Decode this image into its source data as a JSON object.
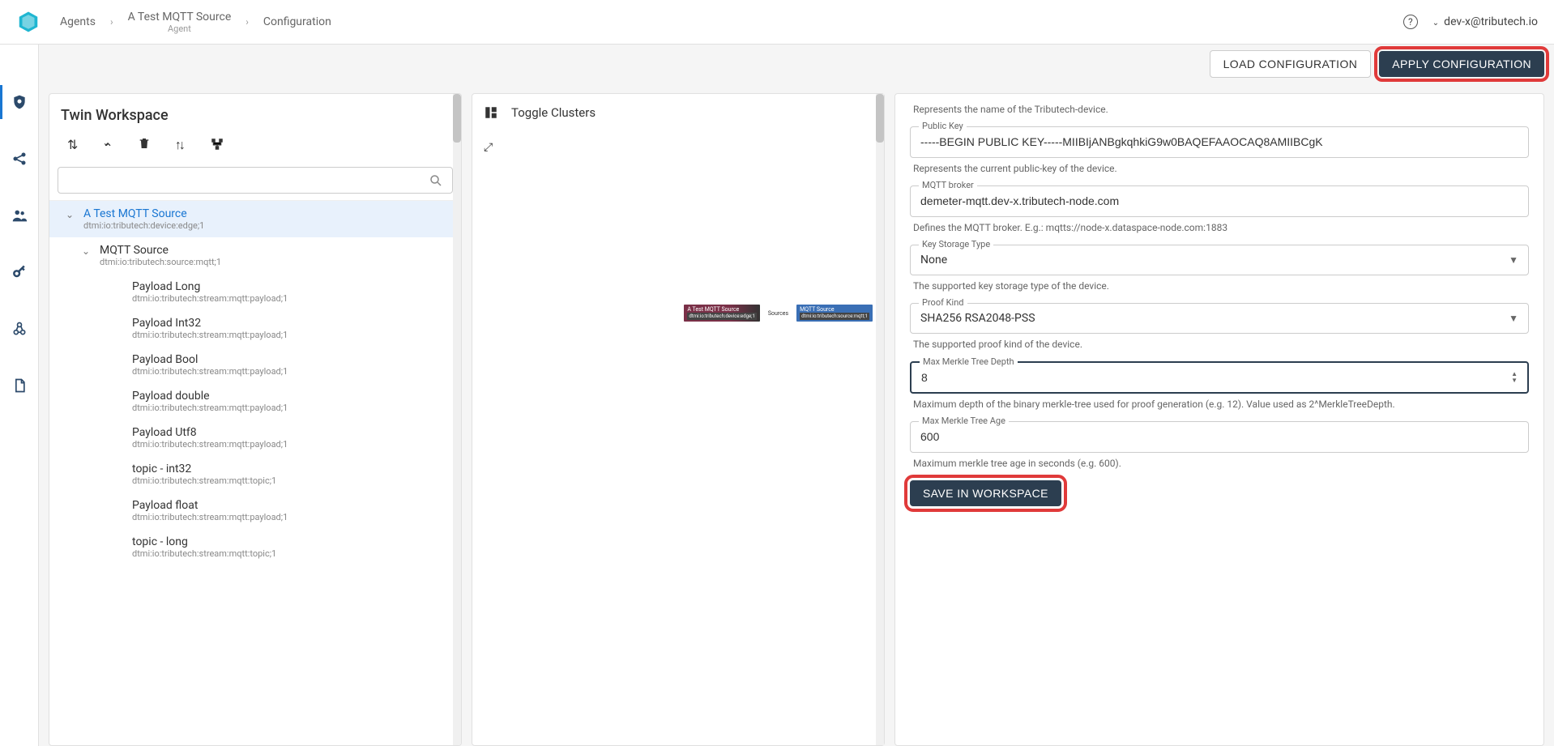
{
  "breadcrumb": {
    "agents": "Agents",
    "item": "A Test MQTT Source",
    "item_sub": "Agent",
    "current": "Configuration"
  },
  "user": "dev-x@tributech.io",
  "actions": {
    "load": "LOAD CONFIGURATION",
    "apply": "APPLY CONFIGURATION"
  },
  "leftpanel": {
    "title": "Twin Workspace"
  },
  "tree": {
    "root": {
      "title": "A Test MQTT Source",
      "sub": "dtmi:io:tributech:device:edge;1"
    },
    "src": {
      "title": "MQTT Source",
      "sub": "dtmi:io:tributech:source:mqtt;1"
    },
    "items": [
      {
        "title": "Payload Long",
        "sub": "dtmi:io:tributech:stream:mqtt:payload;1"
      },
      {
        "title": "Payload Int32",
        "sub": "dtmi:io:tributech:stream:mqtt:payload;1"
      },
      {
        "title": "Payload Bool",
        "sub": "dtmi:io:tributech:stream:mqtt:payload;1"
      },
      {
        "title": "Payload double",
        "sub": "dtmi:io:tributech:stream:mqtt:payload;1"
      },
      {
        "title": "Payload Utf8",
        "sub": "dtmi:io:tributech:stream:mqtt:payload;1"
      },
      {
        "title": "topic - int32",
        "sub": "dtmi:io:tributech:stream:mqtt:topic;1"
      },
      {
        "title": "Payload float",
        "sub": "dtmi:io:tributech:stream:mqtt:payload;1"
      },
      {
        "title": "topic - long",
        "sub": "dtmi:io:tributech:stream:mqtt:topic;1"
      }
    ]
  },
  "mid": {
    "toggle": "Toggle Clusters",
    "g_a": "A Test MQTT Source",
    "g_a_sub": "dtmi:io:tributech:device:edge;1",
    "g_e": "Sources",
    "g_b": "MQTT Source",
    "g_b_sub": "dtmi:io:tributech:source:mqtt;1"
  },
  "form": {
    "name_help": "Represents the name of the Tributech-device.",
    "pubkey_label": "Public Key",
    "pubkey_val": "-----BEGIN PUBLIC KEY-----MIIBIjANBgkqhkiG9w0BAQEFAAOCAQ8AMIIBCgK",
    "pubkey_help": "Represents the current public-key of the device.",
    "broker_label": "MQTT broker",
    "broker_val": "demeter-mqtt.dev-x.tributech-node.com",
    "broker_help": "Defines the MQTT broker. E.g.: mqtts://node-x.dataspace-node.com:1883",
    "kst_label": "Key Storage Type",
    "kst_val": "None",
    "kst_help": "The supported key storage type of the device.",
    "pk_label": "Proof Kind",
    "pk_val": "SHA256 RSA2048-PSS",
    "pk_help": "The supported proof kind of the device.",
    "depth_label": "Max Merkle Tree Depth",
    "depth_val": "8",
    "depth_help": "Maximum depth of the binary merkle-tree used for proof generation (e.g. 12). Value used as 2^MerkleTreeDepth.",
    "age_label": "Max Merkle Tree Age",
    "age_val": "600",
    "age_help": "Maximum merkle tree age in seconds (e.g. 600).",
    "save": "SAVE IN WORKSPACE"
  }
}
